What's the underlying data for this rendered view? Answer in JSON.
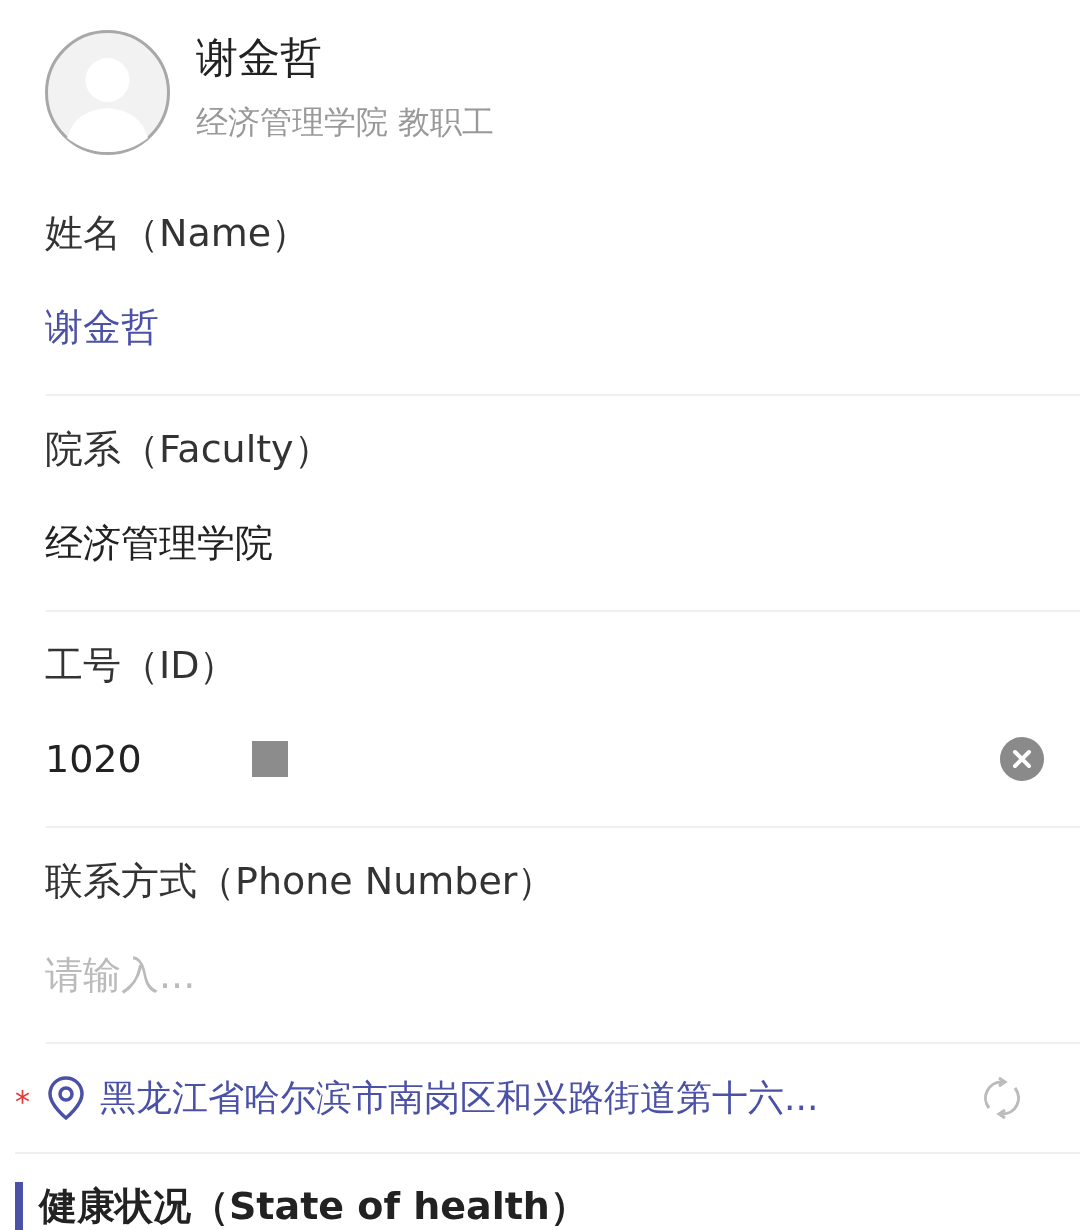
{
  "profile": {
    "name": "谢金哲",
    "subtitle": "经济管理学院 教职工"
  },
  "fields": [
    {
      "kind": "text",
      "label": "姓名（Name）",
      "value": "谢金哲",
      "highlighted": true
    },
    {
      "kind": "text",
      "label": "院系（Faculty）",
      "value": "经济管理学院",
      "highlighted": false
    },
    {
      "kind": "input",
      "label": "工号（ID）",
      "value": "1020",
      "redacted": true,
      "clearable": true
    },
    {
      "kind": "input",
      "label": "联系方式（Phone Number）",
      "placeholder": "请输入..."
    }
  ],
  "location": {
    "required_mark": "*",
    "address": "黑龙江省哈尔滨市南岗区和兴路街道第十六..."
  },
  "section": {
    "title": "健康状况（State of health）"
  }
}
